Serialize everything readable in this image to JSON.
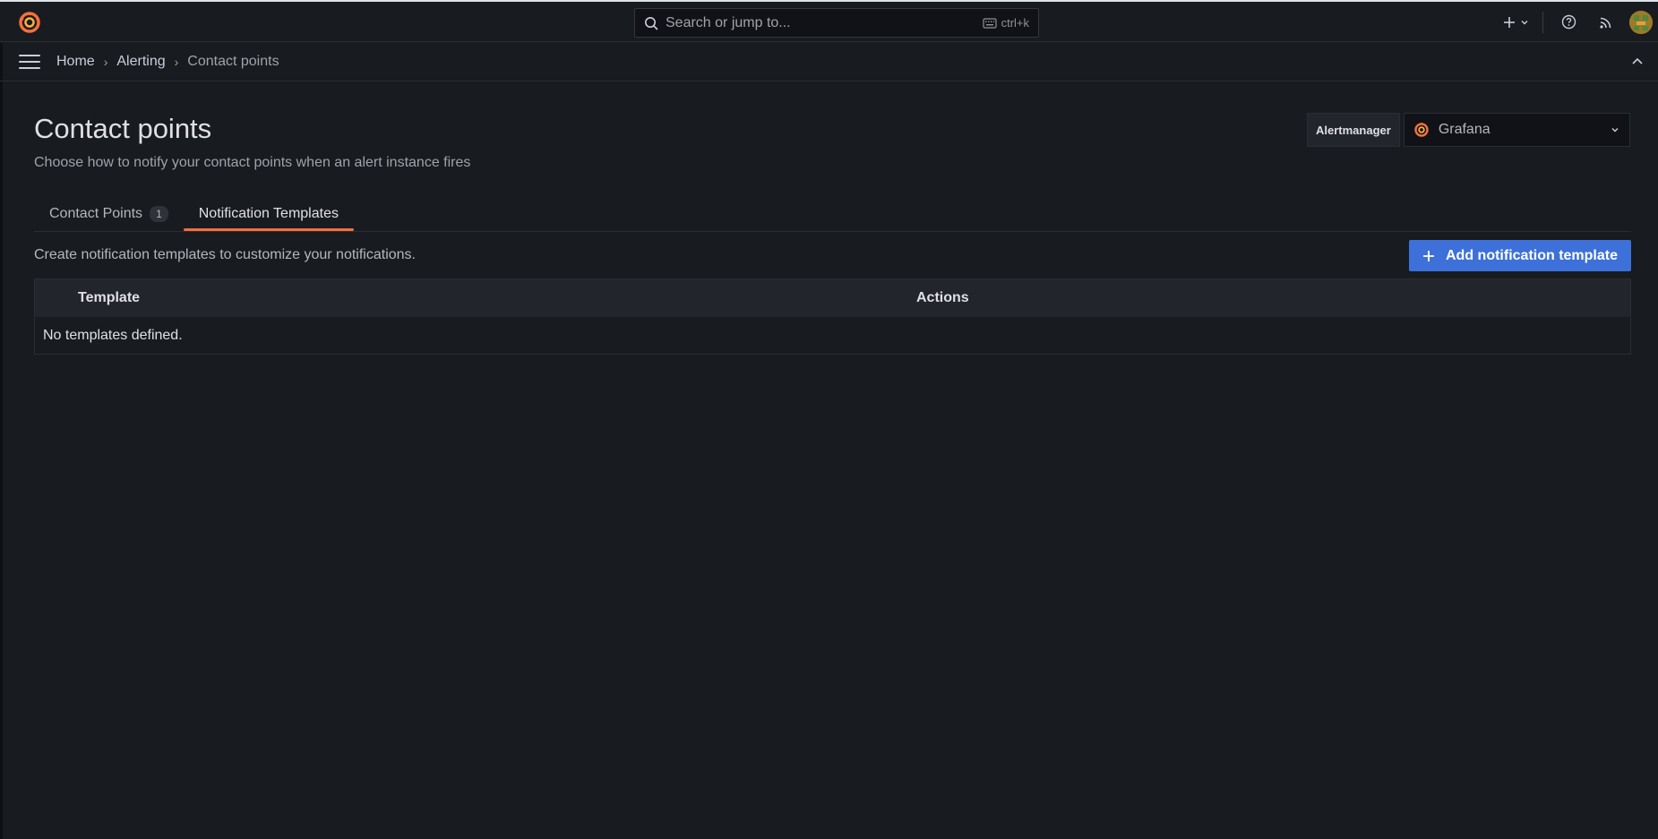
{
  "topbar": {
    "search_placeholder": "Search or jump to...",
    "search_shortcut": "ctrl+k"
  },
  "breadcrumb": {
    "items": [
      "Home",
      "Alerting",
      "Contact points"
    ]
  },
  "page": {
    "title": "Contact points",
    "subtitle": "Choose how to notify your contact points when an alert instance fires"
  },
  "alertmanager": {
    "label": "Alertmanager",
    "selected": "Grafana"
  },
  "tabs": [
    {
      "label": "Contact Points",
      "count": "1",
      "active": false
    },
    {
      "label": "Notification Templates",
      "active": true
    }
  ],
  "templates": {
    "description": "Create notification templates to customize your notifications.",
    "add_button_label": "Add notification template",
    "columns": [
      "Template",
      "Actions"
    ],
    "empty_message": "No templates defined."
  },
  "colors": {
    "accent": "#f56f3f",
    "primary_button": "#3d71d9",
    "background": "#181b1f"
  },
  "icons": {
    "logo": "grafana-logo-icon",
    "search": "search-icon",
    "keyboard": "keyboard-icon",
    "new": "plus-icon",
    "help": "help-circle-icon",
    "news": "rss-icon",
    "menu": "hamburger-menu-icon",
    "collapse": "chevron-up-icon",
    "dropdown": "chevron-down-icon"
  }
}
